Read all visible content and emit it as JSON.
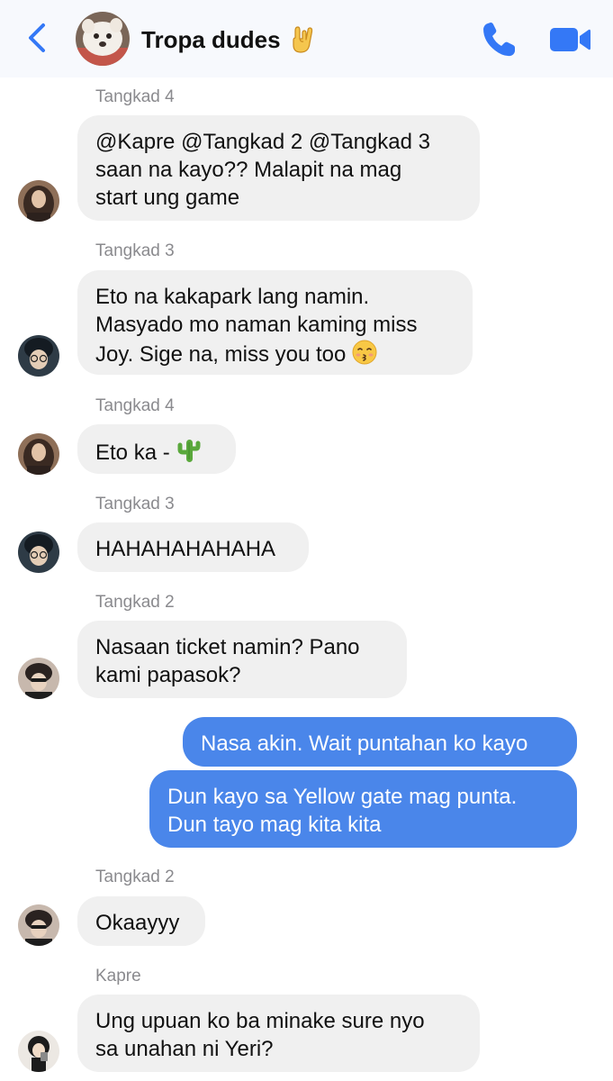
{
  "header": {
    "title": "Tropa dudes",
    "title_emoji": "rock-on-hand",
    "accent": "#3478f6"
  },
  "messages": [
    {
      "sender": "Tangkad  4",
      "text": "@Kapre @Tangkad 2 @Tangkad 3\nsaan na kayo?? Malapit na mag\nstart ung game"
    },
    {
      "sender": "Tangkad 3",
      "text": "Eto na kakapark lang namin.\nMasyado mo naman kaming miss\nJoy. Sige na, miss you too",
      "emoji": "kissing-face"
    },
    {
      "sender": "Tangkad  4",
      "text": "Eto ka -",
      "emoji": "cactus"
    },
    {
      "sender": "Tangkad 3",
      "text": "HAHAHAHAHAHA"
    },
    {
      "sender": "Tangkad 2",
      "text": "Nasaan ticket namin? Pano\nkami papasok?"
    },
    {
      "text": "Nasa akin. Wait puntahan ko kayo",
      "mine": true
    },
    {
      "text": "Dun kayo sa Yellow gate mag punta.\nDun tayo mag kita kita",
      "mine": true
    },
    {
      "sender": "Tangkad 2",
      "text": "Okaayyy"
    },
    {
      "sender": "Kapre",
      "text": "Ung upuan ko ba minake sure nyo\nsa unahan ni Yeri?"
    }
  ],
  "colors": {
    "incoming_bubble": "#f0f0f0",
    "outgoing_bubble": "#4a86ea",
    "sender_label": "#8a8a8e",
    "header_bg": "#f7f9fd"
  }
}
